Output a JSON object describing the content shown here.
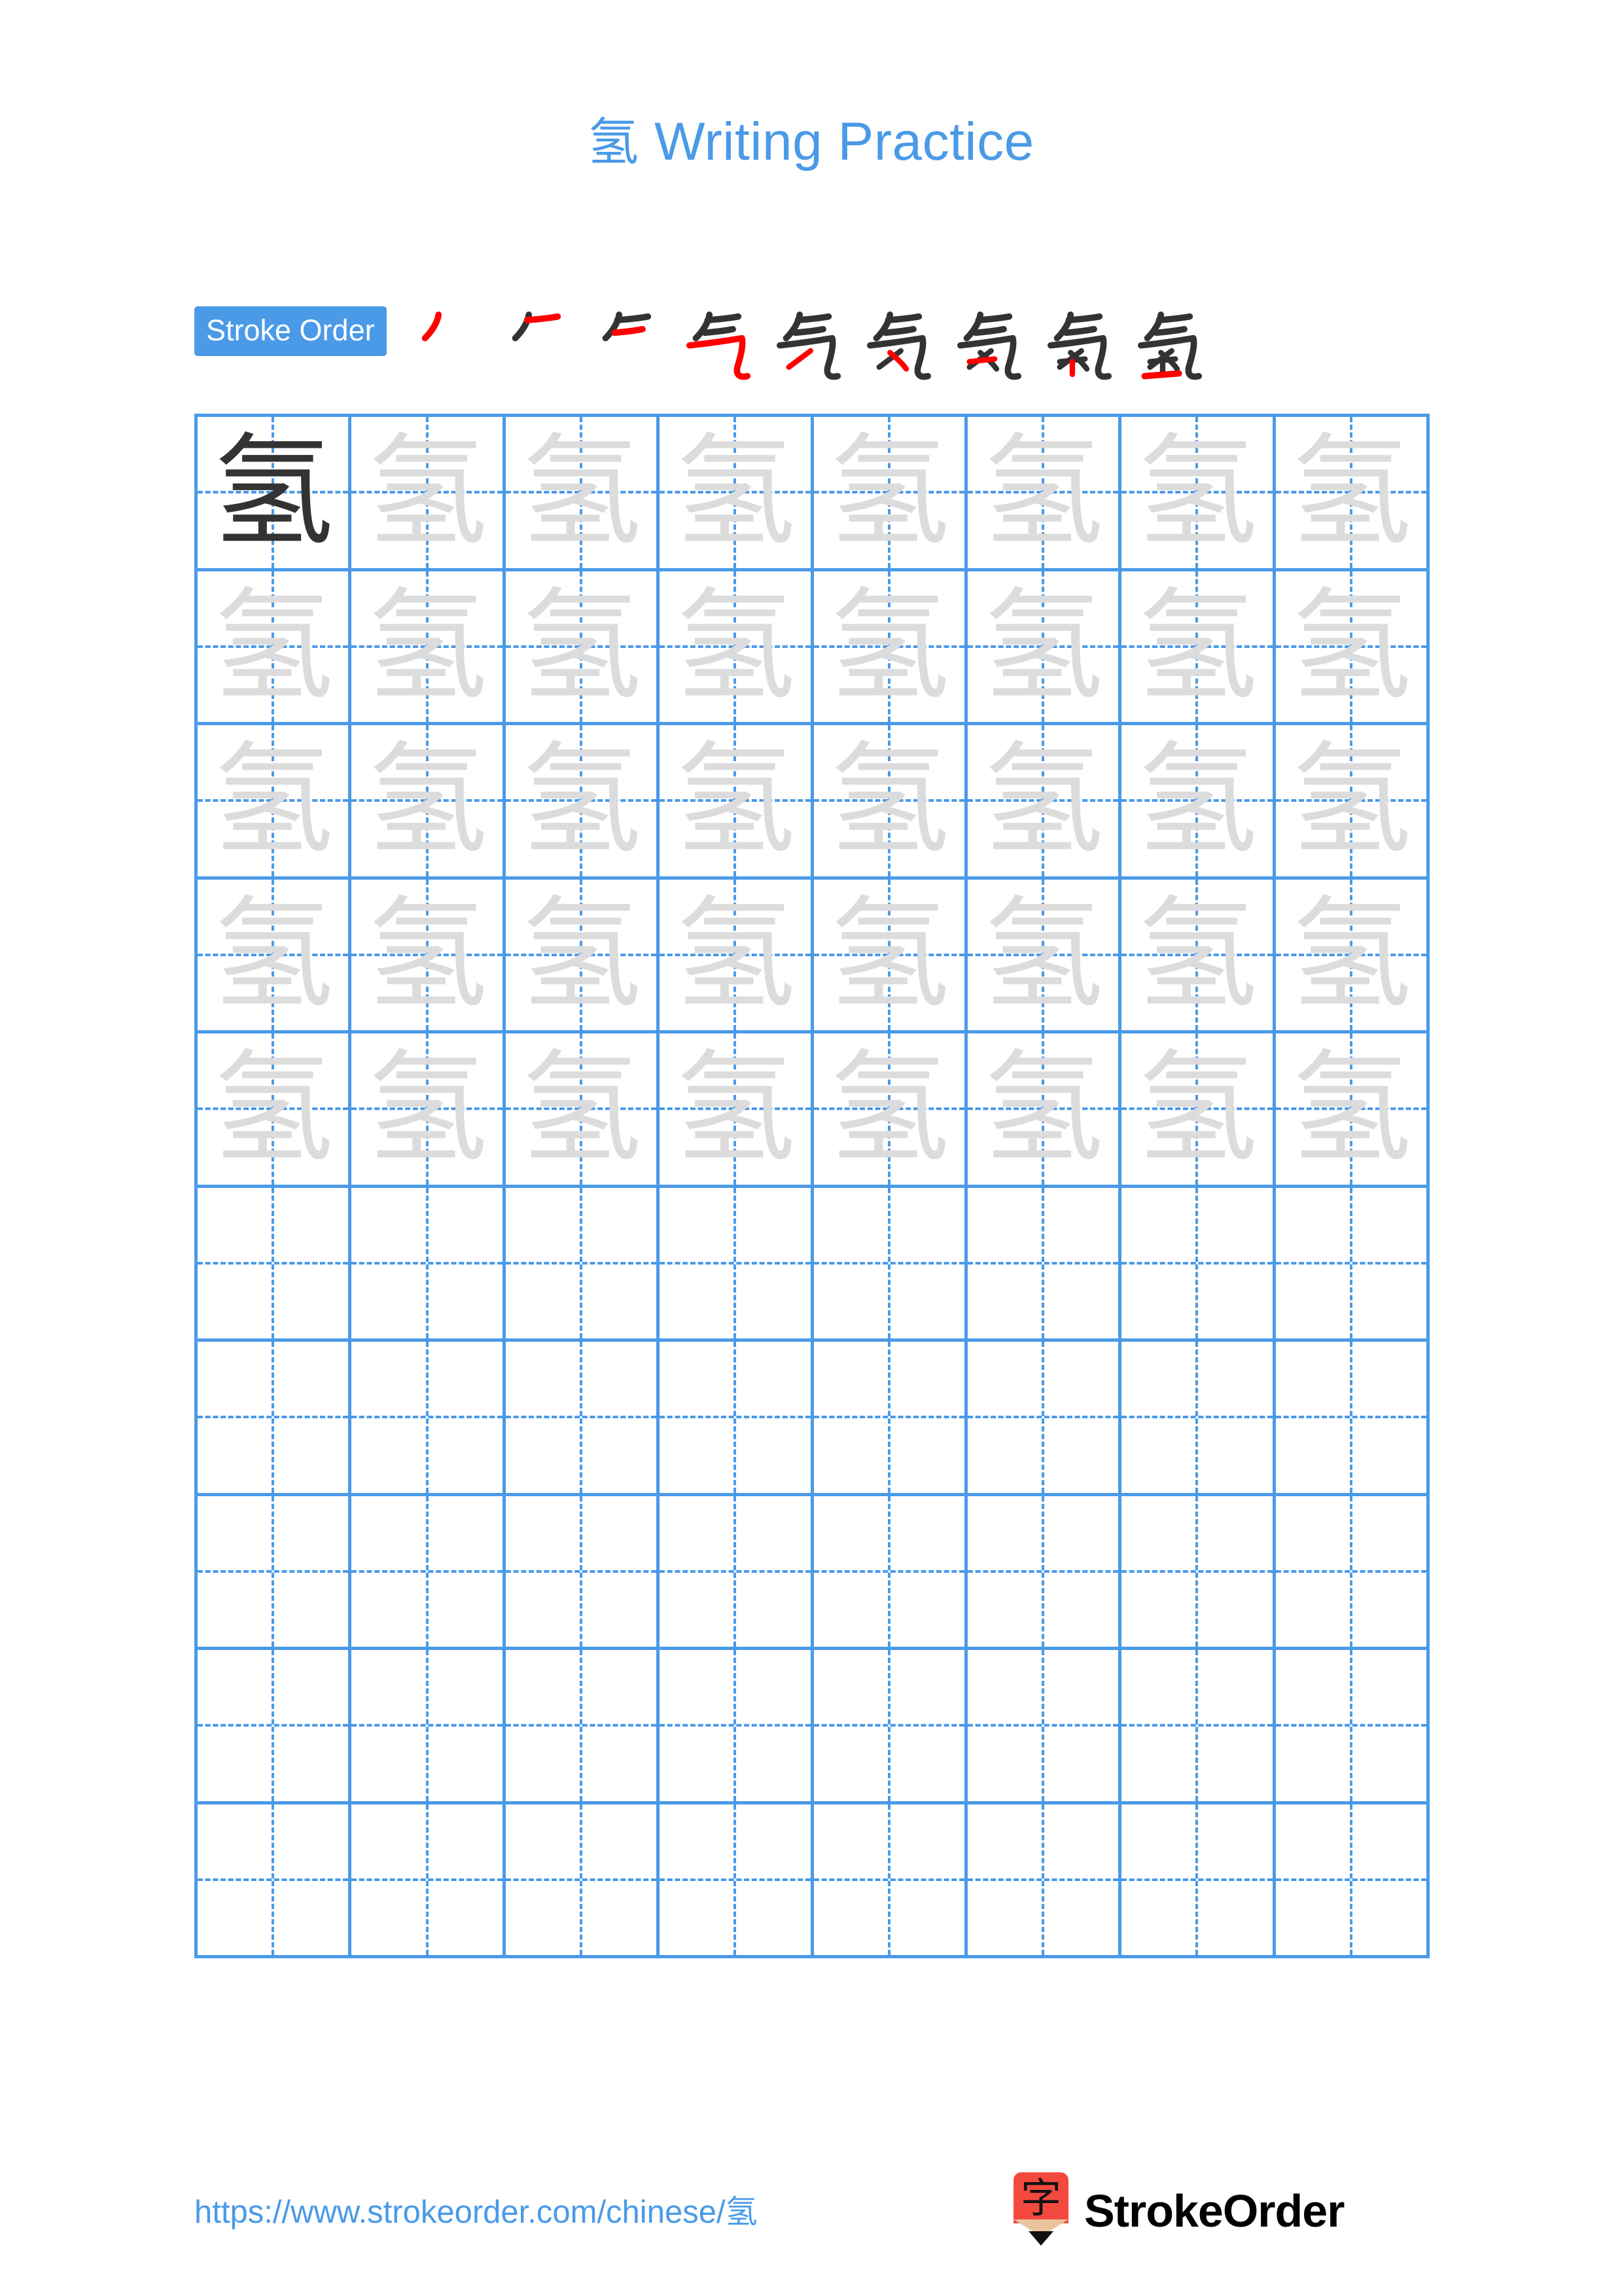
{
  "page": {
    "character": "氢",
    "title_suffix": " Writing Practice",
    "background_color": "#ffffff",
    "accent_color": "#4A9AE8",
    "trace_color": "#DCDCDC",
    "dark_char_color": "#333333",
    "new_stroke_color": "#FF0000"
  },
  "stroke_order": {
    "badge_label": "Stroke Order",
    "total_strokes": 9,
    "steps": [
      {
        "index": 1,
        "name": "stroke-step-1"
      },
      {
        "index": 2,
        "name": "stroke-step-2"
      },
      {
        "index": 3,
        "name": "stroke-step-3"
      },
      {
        "index": 4,
        "name": "stroke-step-4"
      },
      {
        "index": 5,
        "name": "stroke-step-5"
      },
      {
        "index": 6,
        "name": "stroke-step-6"
      },
      {
        "index": 7,
        "name": "stroke-step-7"
      },
      {
        "index": 8,
        "name": "stroke-step-8"
      },
      {
        "index": 9,
        "name": "stroke-step-9"
      }
    ]
  },
  "grid": {
    "columns": 8,
    "rows": 10,
    "filled_rows": 5,
    "empty_rows": 5,
    "first_cell_style": "dark",
    "other_filled_cell_style": "trace",
    "character": "氢"
  },
  "footer": {
    "url_prefix": "https://www.strokeorder.com/chinese/",
    "url_character": "氢",
    "brand_name": "StrokeOrder",
    "logo_glyph": "字",
    "logo_body_color": "#F4493F",
    "logo_wood_color": "#E8C39E"
  }
}
